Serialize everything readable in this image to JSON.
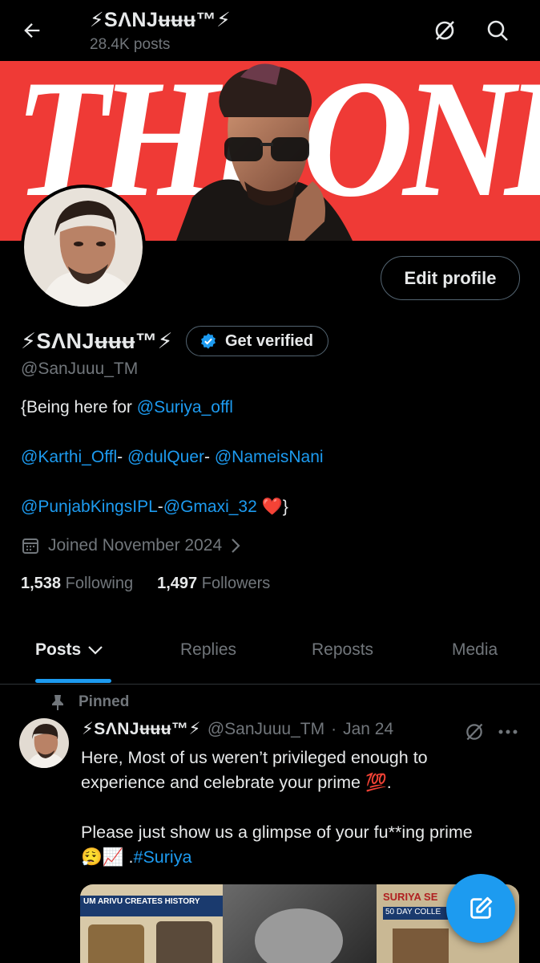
{
  "topbar": {
    "title": "⚡SΛNJʉʉʉ™⚡",
    "posts_count": "28.4K posts",
    "icons": [
      "back-arrow-icon",
      "grok-icon",
      "search-icon"
    ]
  },
  "banner": {
    "text": "THEONE",
    "background_color": "#ef3a36"
  },
  "profile": {
    "edit_label": "Edit profile",
    "display_name": "⚡SΛNJʉʉʉ™⚡",
    "verify_label": "Get verified",
    "handle": "@SanJuuu_TM",
    "bio": {
      "line1_text": "{Being here for ",
      "line1_mention": "@Suriya_offl",
      "line2_m1": "@Karthi_Offl",
      "line2_s1": "- ",
      "line2_m2": "@dulQuer",
      "line2_s2": "- ",
      "line2_m3": "@NameisNani",
      "line3_m1": "@PunjabKingsIPL",
      "line3_s1": "-",
      "line3_m2": "@Gmaxi_32",
      "line3_emoji": "❤️",
      "line3_end": "}"
    },
    "joined": "Joined November 2024",
    "following_count": "1,538",
    "following_label": "Following",
    "followers_count": "1,497",
    "followers_label": "Followers"
  },
  "tabs": [
    {
      "label": "Posts",
      "active": true
    },
    {
      "label": "Replies",
      "active": false
    },
    {
      "label": "Reposts",
      "active": false
    },
    {
      "label": "Media",
      "active": false
    }
  ],
  "pinned_tweet": {
    "pinned_label": "Pinned",
    "name": "⚡SΛNJʉʉʉ™⚡",
    "handle": "@SanJuuu_TM",
    "separator": "·",
    "date": "Jan 24",
    "text_line1": "Here, Most of us weren’t privileged enough to",
    "text_line2": "experience and celebrate your prime 💯.",
    "text_line3": "Please just show us a glimpse of your fu**ing prime",
    "text_line4_emoji": "😮‍💨📈",
    "text_line4_dot": " .",
    "text_line4_tag": "#Suriya",
    "media_captions": [
      "UM ARIVU CREATES HISTORY",
      "SURIYA SE",
      "50 DAY COLLE"
    ]
  },
  "colors": {
    "accent": "#1d9bf0",
    "text_primary": "#e7e9ea",
    "text_secondary": "#71767b",
    "border": "#536471",
    "heart": "#f91880"
  }
}
